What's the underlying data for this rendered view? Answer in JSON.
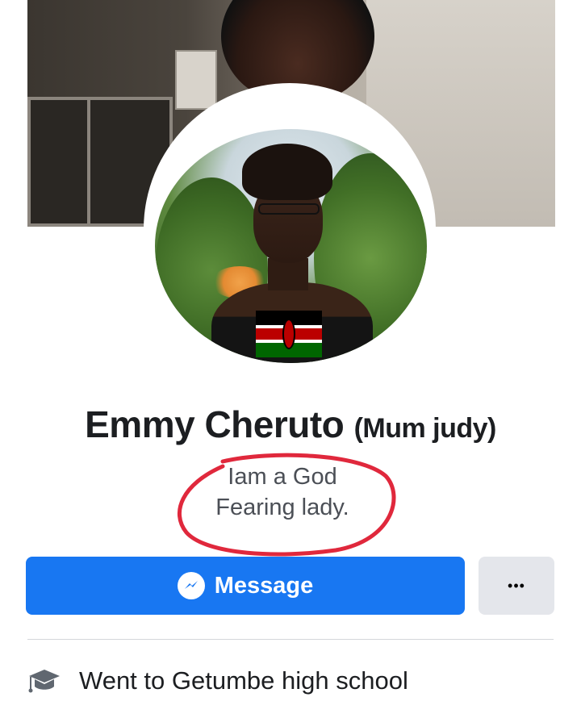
{
  "profile": {
    "name": "Emmy Cheruto",
    "alternate_name": "(Mum judy)",
    "bio_line1": "Iam a God",
    "bio_line2": "Fearing lady."
  },
  "actions": {
    "message_label": "Message",
    "more_label": "•••"
  },
  "intro": {
    "education": "Went to Getumbe high school"
  },
  "colors": {
    "primary": "#1877f2",
    "secondary_button": "#e4e6eb",
    "annotation": "#e0283c"
  },
  "icons": {
    "message": "messenger-icon",
    "more": "more-dots-icon",
    "education": "graduation-cap-icon"
  }
}
